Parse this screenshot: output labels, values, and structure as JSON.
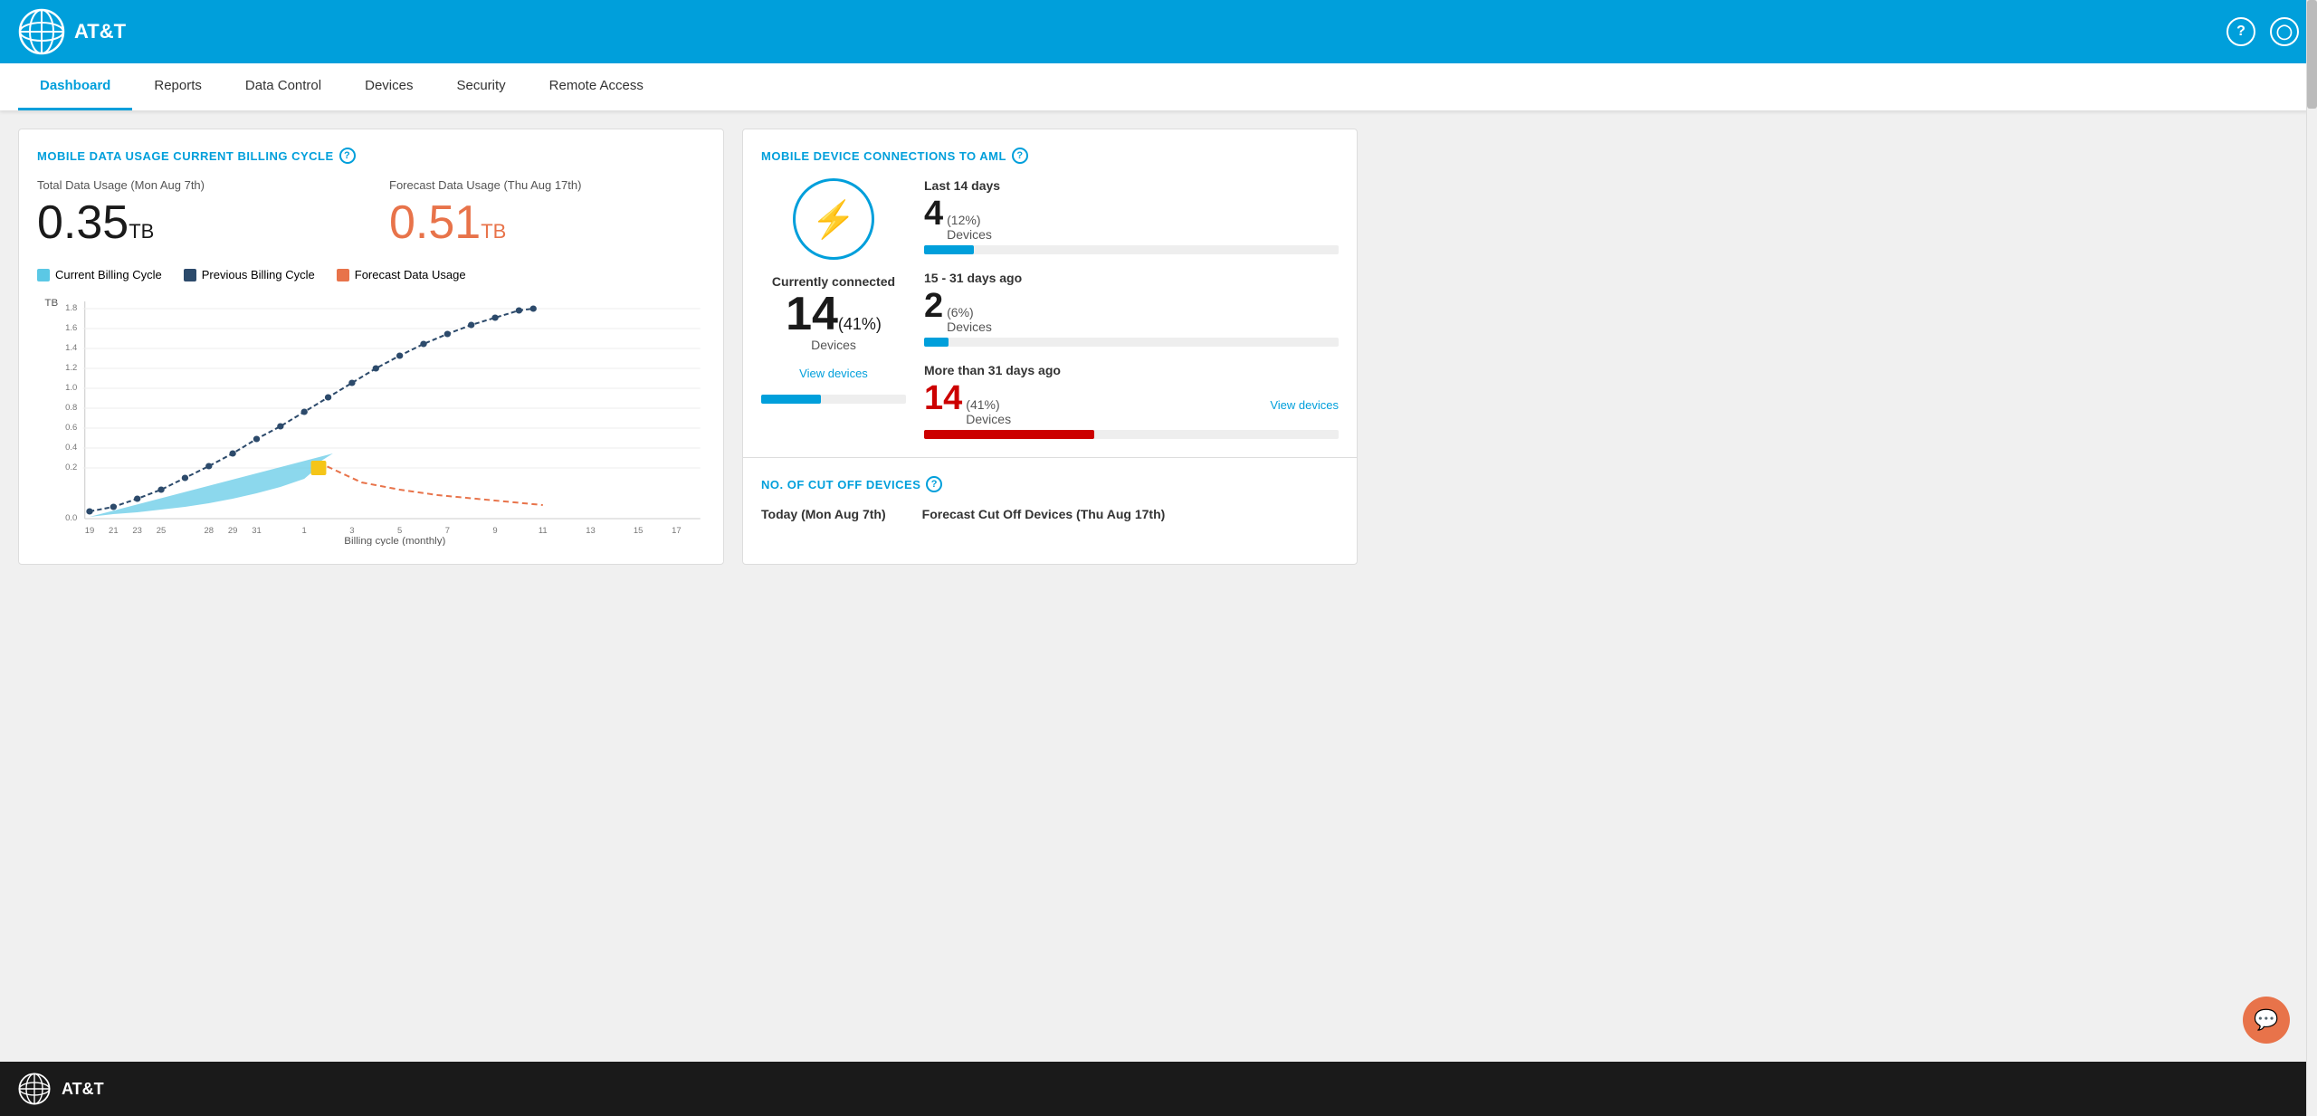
{
  "header": {
    "brand": "AT&T",
    "help_icon": "?",
    "user_icon": "👤"
  },
  "nav": {
    "items": [
      {
        "label": "Dashboard",
        "active": true
      },
      {
        "label": "Reports",
        "active": false
      },
      {
        "label": "Data Control",
        "active": false
      },
      {
        "label": "Devices",
        "active": false
      },
      {
        "label": "Security",
        "active": false
      },
      {
        "label": "Remote Access",
        "active": false
      }
    ]
  },
  "left_panel": {
    "title": "MOBILE DATA USAGE CURRENT BILLING CYCLE",
    "total_label": "Total Data Usage (Mon Aug 7th)",
    "total_value": "0.35",
    "total_unit": "TB",
    "forecast_label": "Forecast Data Usage (Thu Aug 17th)",
    "forecast_value": "0.51",
    "forecast_unit": "TB",
    "legend": [
      {
        "label": "Current Billing Cycle",
        "color": "#5bc8e5"
      },
      {
        "label": "Previous Billing Cycle",
        "color": "#2c4a6b"
      },
      {
        "label": "Forecast Data Usage",
        "color": "#e8734a"
      }
    ],
    "y_axis_label": "TB",
    "y_axis_values": [
      "1.8",
      "1.6",
      "1.4",
      "1.2",
      "1.0",
      "0.8",
      "0.6",
      "0.4",
      "0.2",
      "0.0"
    ],
    "x_axis_label": "Billing cycle (monthly)",
    "x_axis_values": [
      "19",
      "21",
      "23",
      "25",
      "28",
      "29",
      "31",
      "1",
      "3",
      "5",
      "7",
      "9",
      "11",
      "13",
      "15",
      "17"
    ]
  },
  "right_top": {
    "title": "MOBILE DEVICE CONNECTIONS TO AML",
    "connected_label": "Currently connected",
    "connected_number": "14",
    "connected_pct": "(41%)",
    "connected_devices": "Devices",
    "view_link_1": "View devices",
    "last14_label": "Last 14 days",
    "last14_number": "4",
    "last14_pct": "(12%)",
    "last14_devices": "Devices",
    "last14_bar_pct": 12,
    "days15_31_label": "15 - 31 days ago",
    "days15_31_number": "2",
    "days15_31_pct": "(6%)",
    "days15_31_devices": "Devices",
    "days15_31_bar_pct": 6,
    "more31_label": "More than 31 days ago",
    "more31_number": "14",
    "more31_pct": "(41%)",
    "more31_devices": "Devices",
    "more31_bar_pct": 41,
    "view_link_2": "View devices"
  },
  "right_bottom": {
    "title": "NO. OF CUT OFF DEVICES",
    "today_label": "Today (Mon Aug 7th)",
    "forecast_label": "Forecast Cut Off Devices (Thu Aug 17th)"
  },
  "footer": {
    "brand": "AT&T"
  }
}
